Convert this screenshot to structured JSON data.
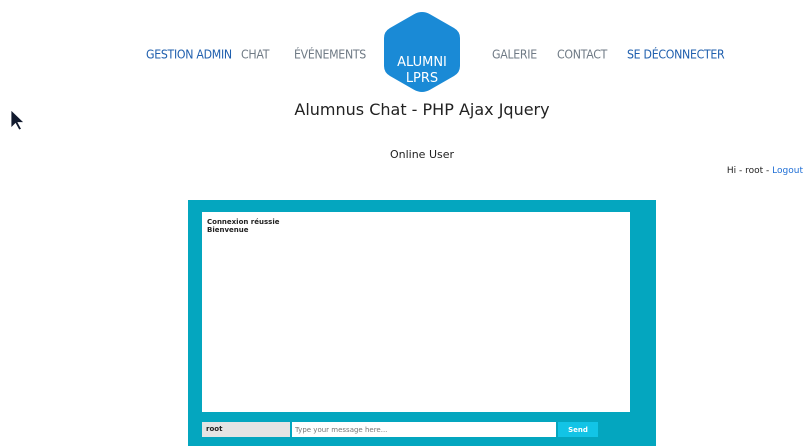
{
  "nav": {
    "left": [
      "GESTION ADMIN",
      "CHAT",
      "ÉVÉNEMENTS"
    ],
    "right": [
      "GALERIE",
      "CONTACT",
      "SE DÉCONNECTER"
    ]
  },
  "logo": {
    "line1": "ALUMNI",
    "line2": "LPRS",
    "icon": "graduation-cap-icon"
  },
  "page": {
    "title": "Alumnus Chat - PHP Ajax Jquery",
    "online_label": "Online User"
  },
  "greeting": {
    "prefix": "Hi - root - ",
    "logout": "Logout"
  },
  "chat": {
    "messages": [
      "Connexion réussie",
      "Bienvenue"
    ],
    "username": "root",
    "input_value": "",
    "input_placeholder": "Type your message here...",
    "send_label": "Send"
  },
  "colors": {
    "brand_blue": "#1a8ad6",
    "chat_teal": "#04a6bf",
    "send_cyan": "#12c4e6"
  }
}
